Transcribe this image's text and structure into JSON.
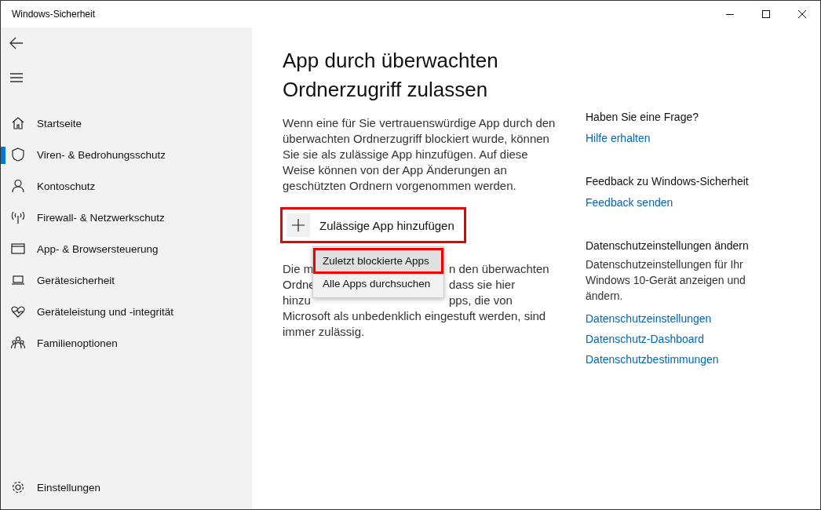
{
  "window": {
    "title": "Windows-Sicherheit"
  },
  "sidebar": {
    "items": [
      {
        "label": "Startseite",
        "selected": false
      },
      {
        "label": "Viren- & Bedrohungsschutz",
        "selected": true
      },
      {
        "label": "Kontoschutz",
        "selected": false
      },
      {
        "label": "Firewall- & Netzwerkschutz",
        "selected": false
      },
      {
        "label": "App- & Browsersteuerung",
        "selected": false
      },
      {
        "label": "Gerätesicherheit",
        "selected": false
      },
      {
        "label": "Geräteleistung und -integrität",
        "selected": false
      },
      {
        "label": "Familienoptionen",
        "selected": false
      }
    ],
    "settings": {
      "label": "Einstellungen"
    }
  },
  "main": {
    "title": "App durch überwachten Ordnerzugriff zulassen",
    "description": "Wenn eine für Sie vertrauenswürdige App durch den überwachten Ordnerzugriff blockiert wurde, können Sie sie als zulässige App hinzufügen. Auf diese Weise können von der App Änderungen an geschützten Ordnern vorgenommen werden.",
    "add_button": {
      "label": "Zulässige App hinzufügen",
      "highlighted": true
    },
    "menu": [
      {
        "label": "Zuletzt blockierte Apps",
        "highlighted": true
      },
      {
        "label": "Alle Apps durchsuchen",
        "highlighted": false
      }
    ],
    "covered_lines": [
      {
        "left": "Die m",
        "right": "n den überwachten"
      },
      {
        "left": "Ordne",
        "right": "dass sie hier"
      },
      {
        "left": "hinzu",
        "right": "pps, die von"
      }
    ],
    "visible_lines": [
      "Microsoft als unbedenklich eingestuft werden, sind",
      "immer zulässig."
    ]
  },
  "aside": {
    "sections": [
      {
        "heading": "Haben Sie eine Frage?",
        "links": [
          "Hilfe erhalten"
        ]
      },
      {
        "heading": "Feedback zu Windows-Sicherheit",
        "links": [
          "Feedback senden"
        ]
      },
      {
        "heading": "Datenschutzeinstellungen ändern",
        "text": "Datenschutzeinstellungen für Ihr Windows 10-Gerät anzeigen und ändern.",
        "links": [
          "Datenschutzeinstellungen",
          "Datenschutz-Dashboard",
          "Datenschutzbestimmungen"
        ]
      }
    ]
  }
}
